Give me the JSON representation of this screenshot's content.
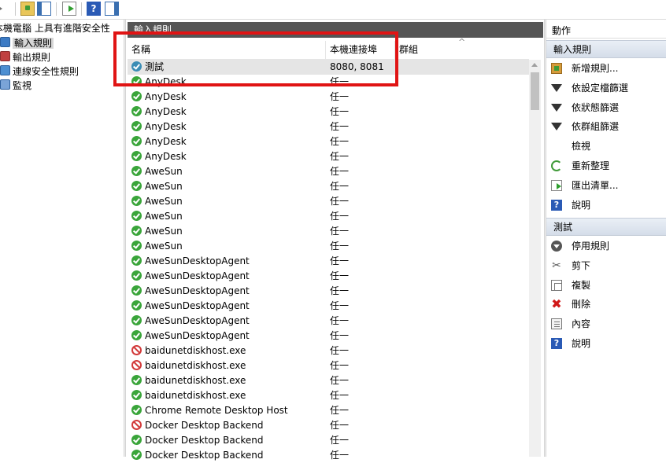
{
  "tree": {
    "root": "本機電腦 上具有進階安全性",
    "items": [
      {
        "label": "輸入規則",
        "icon": "inbound-rules-icon",
        "selected": true
      },
      {
        "label": "輸出規則",
        "icon": "outbound-rules-icon",
        "selected": false
      },
      {
        "label": "連線安全性規則",
        "icon": "connection-security-icon",
        "selected": false
      },
      {
        "label": "監視",
        "icon": "monitor-icon",
        "selected": false
      }
    ]
  },
  "center": {
    "title": "輸入規則",
    "columns": {
      "name": "名稱",
      "port": "本機連接埠",
      "group": "群組"
    },
    "rows": [
      {
        "name": "測試",
        "port": "8080, 8081",
        "status": "custom",
        "selected": true
      },
      {
        "name": "AnyDesk",
        "port": "任一",
        "status": "allow"
      },
      {
        "name": "AnyDesk",
        "port": "任一",
        "status": "allow"
      },
      {
        "name": "AnyDesk",
        "port": "任一",
        "status": "allow"
      },
      {
        "name": "AnyDesk",
        "port": "任一",
        "status": "allow"
      },
      {
        "name": "AnyDesk",
        "port": "任一",
        "status": "allow"
      },
      {
        "name": "AnyDesk",
        "port": "任一",
        "status": "allow"
      },
      {
        "name": "AweSun",
        "port": "任一",
        "status": "allow"
      },
      {
        "name": "AweSun",
        "port": "任一",
        "status": "allow"
      },
      {
        "name": "AweSun",
        "port": "任一",
        "status": "allow"
      },
      {
        "name": "AweSun",
        "port": "任一",
        "status": "allow"
      },
      {
        "name": "AweSun",
        "port": "任一",
        "status": "allow"
      },
      {
        "name": "AweSun",
        "port": "任一",
        "status": "allow"
      },
      {
        "name": "AweSunDesktopAgent",
        "port": "任一",
        "status": "allow"
      },
      {
        "name": "AweSunDesktopAgent",
        "port": "任一",
        "status": "allow"
      },
      {
        "name": "AweSunDesktopAgent",
        "port": "任一",
        "status": "allow"
      },
      {
        "name": "AweSunDesktopAgent",
        "port": "任一",
        "status": "allow"
      },
      {
        "name": "AweSunDesktopAgent",
        "port": "任一",
        "status": "allow"
      },
      {
        "name": "AweSunDesktopAgent",
        "port": "任一",
        "status": "allow"
      },
      {
        "name": "baidunetdiskhost.exe",
        "port": "任一",
        "status": "block"
      },
      {
        "name": "baidunetdiskhost.exe",
        "port": "任一",
        "status": "block"
      },
      {
        "name": "baidunetdiskhost.exe",
        "port": "任一",
        "status": "allow"
      },
      {
        "name": "baidunetdiskhost.exe",
        "port": "任一",
        "status": "allow"
      },
      {
        "name": "Chrome Remote Desktop Host",
        "port": "任一",
        "status": "allow"
      },
      {
        "name": "Docker Desktop Backend",
        "port": "任一",
        "status": "block"
      },
      {
        "name": "Docker Desktop Backend",
        "port": "任一",
        "status": "allow"
      },
      {
        "name": "Docker Desktop Backend",
        "port": "任一",
        "status": "allow"
      }
    ]
  },
  "actions": {
    "title": "動作",
    "section1": "輸入規則",
    "items1": [
      {
        "label": "新增規則...",
        "icon": "new-rule-icon"
      },
      {
        "label": "依設定檔篩選",
        "icon": "filter-icon"
      },
      {
        "label": "依狀態篩選",
        "icon": "filter-icon"
      },
      {
        "label": "依群組篩選",
        "icon": "filter-icon"
      },
      {
        "label": "檢視",
        "icon": ""
      },
      {
        "label": "重新整理",
        "icon": "refresh-icon"
      },
      {
        "label": "匯出清單...",
        "icon": "export-list-icon"
      },
      {
        "label": "說明",
        "icon": "help-icon"
      }
    ],
    "section2": "測試",
    "items2": [
      {
        "label": "停用規則",
        "icon": "disable-rule-icon"
      },
      {
        "label": "剪下",
        "icon": "cut-icon"
      },
      {
        "label": "複製",
        "icon": "copy-icon"
      },
      {
        "label": "刪除",
        "icon": "delete-icon"
      },
      {
        "label": "內容",
        "icon": "properties-icon"
      },
      {
        "label": "說明",
        "icon": "help-icon"
      }
    ]
  },
  "annotation_color": "#e01414"
}
